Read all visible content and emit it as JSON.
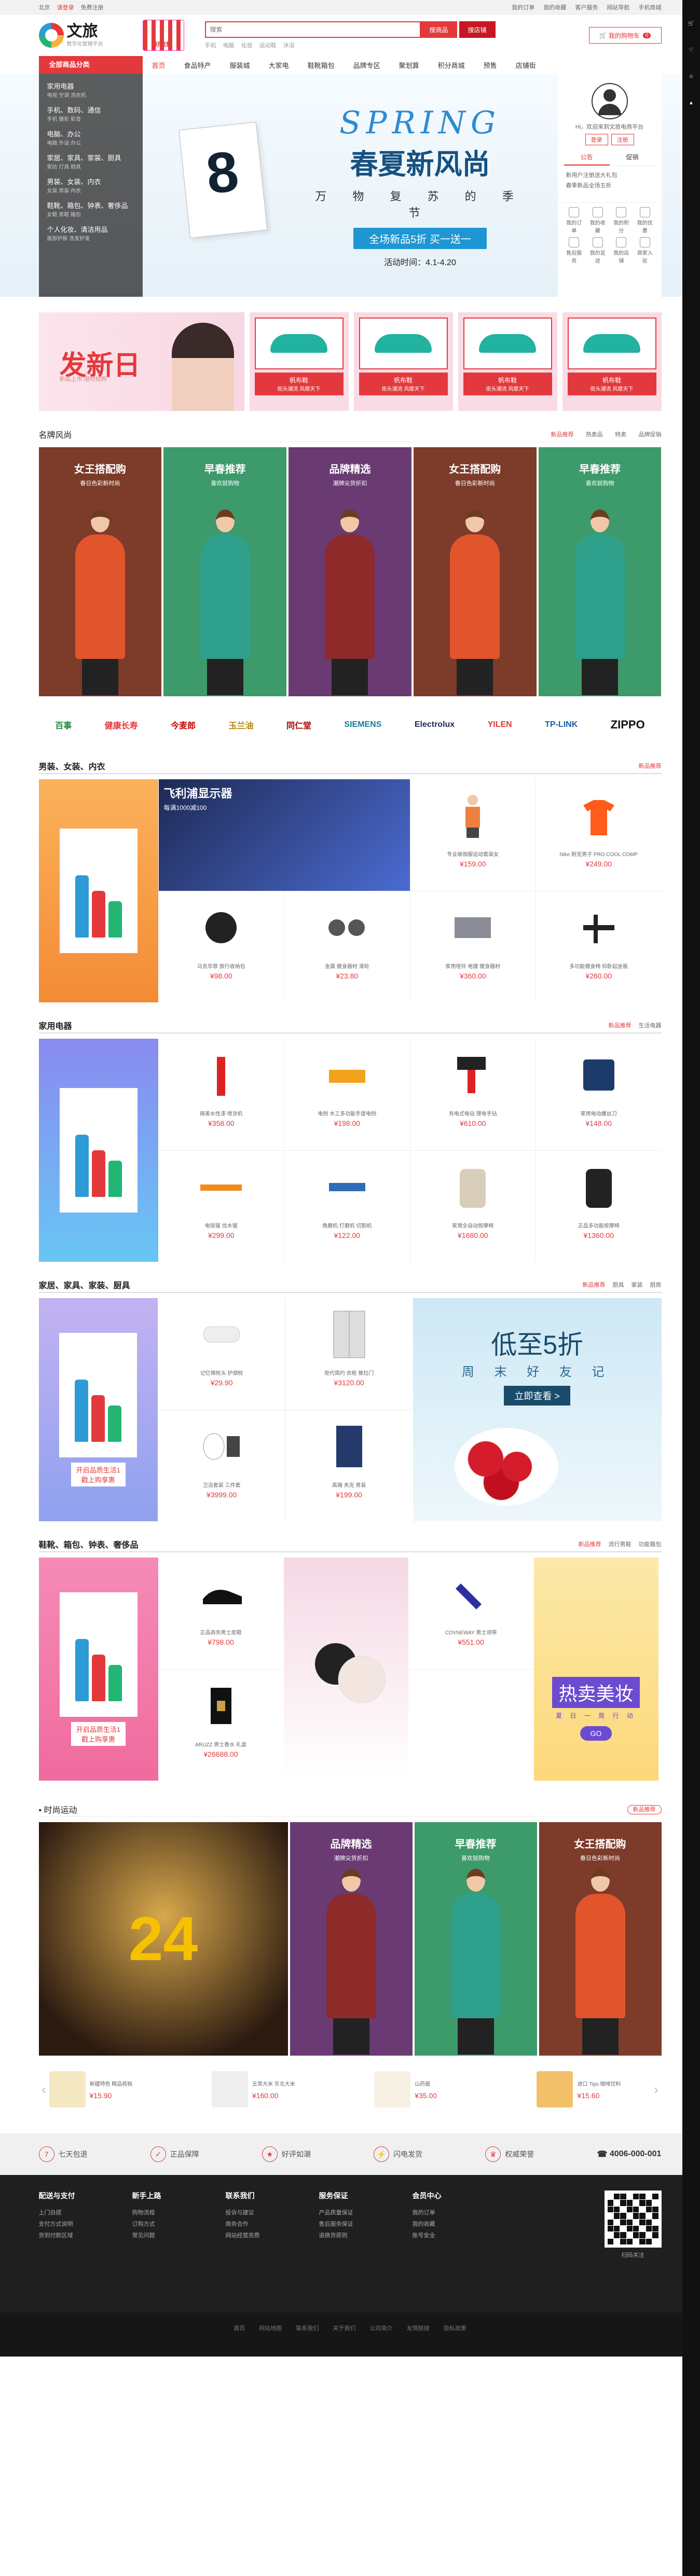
{
  "topbar": {
    "location": "北京",
    "login": "请登录",
    "register": "免费注册",
    "links": [
      "我的订单",
      "我的收藏",
      "客户服务",
      "网站导航",
      "手机商城"
    ]
  },
  "header": {
    "logo_name": "文旅",
    "logo_sub": "数字化管理平台",
    "badge": "好货集",
    "search_placeholder": "搜索",
    "search_btn": "搜商品",
    "search_store_btn": "搜店铺",
    "hot_words": [
      "手机",
      "电脑",
      "化妆",
      "运动鞋",
      "沐浴"
    ],
    "cart_label": "我的购物车",
    "cart_count": "0"
  },
  "nav": {
    "cat_title": "全部商品分类",
    "items": [
      "首页",
      "食品特产",
      "服装城",
      "大家电",
      "鞋靴箱包",
      "品牌专区",
      "聚划算",
      "积分商城",
      "预售",
      "店铺街"
    ]
  },
  "categories": [
    {
      "title": "家用电器",
      "sub": "电视 空调 洗衣机"
    },
    {
      "title": "手机、数码、通信",
      "sub": "手机 摄影 影音"
    },
    {
      "title": "电脑、办公",
      "sub": "电脑 外设 办公"
    },
    {
      "title": "家居、家具、家装、厨具",
      "sub": "家纺 灯具 厨具"
    },
    {
      "title": "男装、女装、内衣",
      "sub": "女装 男装 内衣"
    },
    {
      "title": "鞋靴、箱包、钟表、奢侈品",
      "sub": "女鞋 男鞋 箱包"
    },
    {
      "title": "个人化妆、清洁用品",
      "sub": "面部护肤 洗发护发"
    }
  ],
  "hero": {
    "spring": "SPRING",
    "title": "春夏新风尚",
    "subtitle": "万 物 复 苏 的 季 节",
    "button": "全场新品5折 买一送一",
    "date": "活动时间：4.1-4.20"
  },
  "user_panel": {
    "greeting": "Hi，欢迎来到文旅电商平台",
    "login": "登录",
    "register": "注册",
    "tabs": [
      "公告",
      "促销"
    ],
    "news": [
      "新用户注册送大礼包",
      "春季新品全场五折"
    ],
    "apps": [
      "我的订单",
      "我的收藏",
      "我的积分",
      "我的优惠",
      "售后服务",
      "我的足迹",
      "我的店铺",
      "商家入驻"
    ]
  },
  "promo": {
    "title": "发新日",
    "sub": "新品上市 限时抢购",
    "cards": [
      {
        "name": "帆布鞋",
        "sub": "街头潮流 风靡天下"
      },
      {
        "name": "帆布鞋",
        "sub": "街头潮流 风靡天下"
      },
      {
        "name": "帆布鞋",
        "sub": "街头潮流 风靡天下"
      },
      {
        "name": "帆布鞋",
        "sub": "街头潮流 风靡天下"
      }
    ]
  },
  "brand": {
    "title": "名牌风尚",
    "tabs": [
      "新品推荐",
      "热卖品",
      "特卖",
      "品牌促销"
    ],
    "banners": [
      {
        "title": "女王搭配购",
        "sub": "春日色彩新时尚",
        "color": "#7d3b2a",
        "body": "#e2542c"
      },
      {
        "title": "早春推荐",
        "sub": "喜欢就购物",
        "color": "#3d9a6b",
        "body": "#2fa08c"
      },
      {
        "title": "品牌精选",
        "sub": "潮牌尖货折扣",
        "color": "#6a3a72",
        "body": "#8e2a2a"
      },
      {
        "title": "女王搭配购",
        "sub": "春日色彩新时尚",
        "color": "#7d3b2a",
        "body": "#e2542c"
      },
      {
        "title": "早春推荐",
        "sub": "喜欢就购物",
        "color": "#3d9a6b",
        "body": "#2fa08c"
      }
    ]
  },
  "logos": [
    "百事",
    "健康长寿",
    "今麦郎",
    "玉兰油",
    "同仁堂",
    "SIEMENS",
    "Electrolux",
    "YILEN",
    "TP-LINK",
    "ZIPPO"
  ],
  "floor1": {
    "title": "男装、女装、内衣",
    "tab": "新品推荐",
    "ad_title": "飞利浦显示器",
    "ad_sub": "每满1000减100",
    "items": [
      {
        "name": "专业瑜伽服运动套装女",
        "price": "¥159.00"
      },
      {
        "name": "Nike 耐克男子 PRO COOL COMP",
        "price": "¥249.00"
      },
      {
        "name": "马克华菲 旅行收纳包",
        "price": "¥98.00"
      },
      {
        "name": "金属 健身器材 滑轮",
        "price": "¥23.80"
      },
      {
        "name": "家用哑铃 电镀 健身器材",
        "price": "¥360.00"
      },
      {
        "name": "多功能健身椅 仰卧起坐板",
        "price": "¥260.00"
      }
    ]
  },
  "floor2": {
    "title": "家用电器",
    "tabs": [
      "新品推荐",
      "生活电器"
    ],
    "items": [
      {
        "name": "铸美水性漆 喷涂机",
        "price": "¥358.00"
      },
      {
        "name": "电刨 木工多功能手提电刨",
        "price": "¥198.00"
      },
      {
        "name": "充电式电钻 锂电手钻",
        "price": "¥610.00"
      },
      {
        "name": "家用电动螺丝刀",
        "price": "¥148.00"
      },
      {
        "name": "电链锯 伐木锯",
        "price": "¥299.00"
      },
      {
        "name": "角磨机 打磨机 切割机",
        "price": "¥122.00"
      },
      {
        "name": "家用全自动按摩椅",
        "price": "¥1680.00"
      },
      {
        "name": "正品多功能按摩椅",
        "price": "¥1360.00"
      }
    ]
  },
  "floor3": {
    "title": "家居、家具、家装、厨具",
    "tabs": [
      "新品推荐",
      "厨具",
      "家装",
      "厨房"
    ],
    "ad_label": "开启品质生活1",
    "ad_sub": "戳上购享惠",
    "items": [
      {
        "name": "记忆棉枕头 护颈枕",
        "price": "¥29.90"
      },
      {
        "name": "现代简约 衣柜 推拉门",
        "price": "¥3120.00"
      },
      {
        "name": "卫浴套装 三件套",
        "price": "¥3999.00"
      },
      {
        "name": "高端 夹克 男装",
        "price": "¥199.00"
      }
    ],
    "banner_title": "低至5折",
    "banner_sub": "周 末 好 友 记",
    "banner_btn": "立即查看 >"
  },
  "floor4": {
    "title": "鞋靴、箱包、钟表、奢侈品",
    "tabs": [
      "新品推荐",
      "流行男鞋",
      "功能箱包"
    ],
    "ad_label": "开启品质生活1",
    "ad_sub": "戳上购享惠",
    "items": [
      {
        "name": "正品商务男士皮鞋",
        "price": "¥798.00"
      },
      {
        "name": "COVNEWAY 男士领带",
        "price": "¥551.00"
      },
      {
        "name": "ARUZZ 男士香水 礼盒",
        "price": "¥26688.00"
      }
    ],
    "banner_title": "热卖美妆",
    "banner_sub": "夏 日 一 周 行 动",
    "banner_btn": "GO"
  },
  "sport": {
    "title": "时尚运动",
    "tab": "新品推荐",
    "jersey": "24",
    "banners": [
      {
        "title": "品牌精选",
        "sub": "潮牌尖货折扣",
        "color": "#6a3a72",
        "body": "#8e2a2a"
      },
      {
        "title": "早春推荐",
        "sub": "喜欢就购物",
        "color": "#3d9a6b",
        "body": "#2fa08c"
      },
      {
        "title": "女王搭配购",
        "sub": "春日色彩新时尚",
        "color": "#7d3b2a",
        "body": "#e2542c"
      }
    ],
    "slider": [
      {
        "name": "新疆特色 精品核桃",
        "price": "¥15.90"
      },
      {
        "name": "五常大米 东北大米",
        "price": "¥160.00"
      },
      {
        "name": "山药面",
        "price": "¥35.00"
      },
      {
        "name": "进口 Tips 咖啡饮料",
        "price": "¥15.60"
      }
    ]
  },
  "service": {
    "items": [
      "七天包退",
      "正品保障",
      "好评如潮",
      "闪电发货",
      "权威荣誉"
    ],
    "phone": "4006-000-001"
  },
  "footer": {
    "cols": [
      {
        "title": "配送与支付",
        "items": [
          "上门自提",
          "支付方式说明",
          "货到付款区域"
        ]
      },
      {
        "title": "新手上路",
        "items": [
          "购物流程",
          "订购方式",
          "常见问题"
        ]
      },
      {
        "title": "联系我们",
        "items": [
          "投诉与建议",
          "商务合作",
          "网站经营资质"
        ]
      },
      {
        "title": "服务保证",
        "items": [
          "产品质量保证",
          "售后服务保证",
          "退换货原则"
        ]
      },
      {
        "title": "会员中心",
        "items": [
          "我的订单",
          "我的收藏",
          "账号安全"
        ]
      }
    ],
    "qr_label": "扫码关注",
    "copy": [
      "首页",
      "网站地图",
      "联系我们",
      "关于我们",
      "公司简介",
      "友情链接",
      "隐私政策"
    ]
  }
}
